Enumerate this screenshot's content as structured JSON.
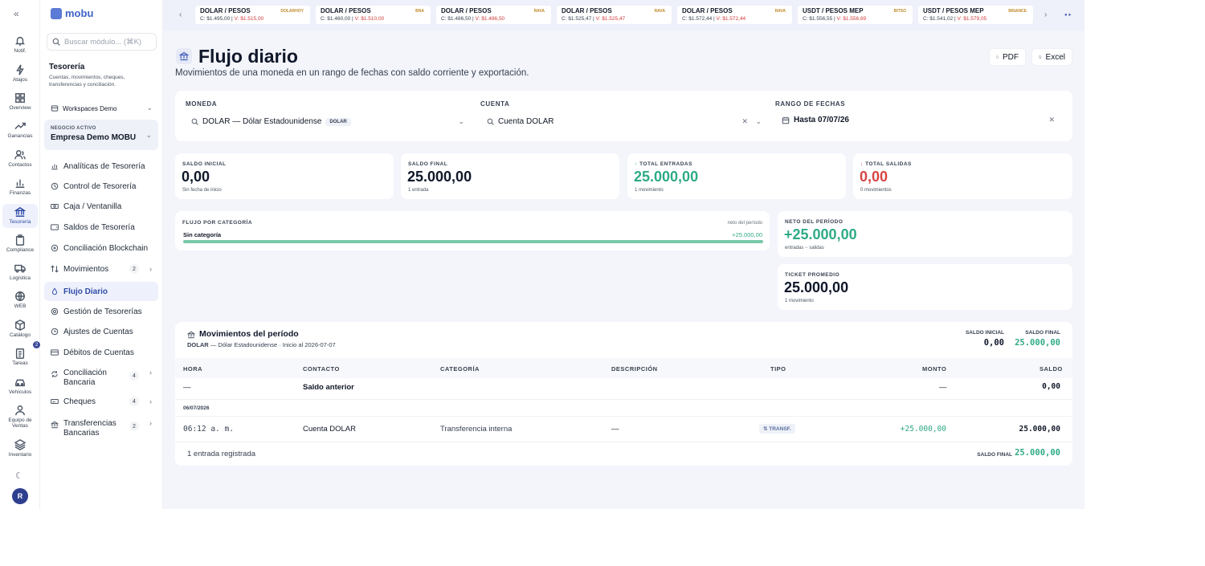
{
  "rail": {
    "items": [
      {
        "label": "Notif.",
        "icon": "bell-icon"
      },
      {
        "label": "Atajos",
        "icon": "bolt-icon"
      },
      {
        "label": "Overview",
        "icon": "grid-icon"
      },
      {
        "label": "Ganancias",
        "icon": "trend-icon"
      },
      {
        "label": "Contactos",
        "icon": "users-icon"
      },
      {
        "label": "Finanzas",
        "icon": "bar-chart-icon"
      },
      {
        "label": "Tesorería",
        "icon": "bank-icon"
      },
      {
        "label": "Compliance",
        "icon": "clipboard-icon"
      },
      {
        "label": "Logística",
        "icon": "box-icon"
      },
      {
        "label": "WEB",
        "icon": "globe-icon"
      },
      {
        "label": "Catálogo",
        "icon": "cube-icon"
      },
      {
        "label": "Tareas",
        "icon": "checklist-icon"
      },
      {
        "label": "Vehículos",
        "icon": "car-icon"
      },
      {
        "label": "Equipo de Ventas",
        "icon": "team-icon"
      },
      {
        "label": "Inventario",
        "icon": "layers-icon"
      }
    ],
    "tasks_badge": "2",
    "avatar": "R"
  },
  "sidebar": {
    "brand": "mobu",
    "search_placeholder": "Buscar módulo... (⌘K)",
    "section_title": "Tesorería",
    "section_sub": "Cuentas, movimientos, cheques, transferencias y conciliación.",
    "workspace": "Workspaces Demo",
    "business_label": "NEGOCIO ACTIVO",
    "business_name": "Empresa Demo MOBU",
    "nav": [
      {
        "label": "Analíticas de Tesorería"
      },
      {
        "label": "Control de Tesorería"
      },
      {
        "label": "Caja / Ventanilla"
      },
      {
        "label": "Saldos de Tesorería"
      },
      {
        "label": "Conciliación Blockchain"
      },
      {
        "label": "Movimientos",
        "count": "2"
      },
      {
        "label": "Flujo Diario"
      },
      {
        "label": "Gestión de Tesorerías"
      },
      {
        "label": "Ajustes de Cuentas"
      },
      {
        "label": "Débitos de Cuentas"
      },
      {
        "label": "Conciliación Bancaria",
        "count": "4"
      },
      {
        "label": "Cheques",
        "count": "4"
      },
      {
        "label": "Transferencias Bancarias",
        "count": "2"
      }
    ]
  },
  "ticker": [
    {
      "pair": "DOLAR / PESOS",
      "src": "DOLARHOY",
      "c": "C: $1.495,00",
      "v": "V: $1.515,00"
    },
    {
      "pair": "DOLAR / PESOS",
      "src": "BNA",
      "c": "C: $1.460,00",
      "v": "V: $1.510,00"
    },
    {
      "pair": "DOLAR / PESOS",
      "src": "RAVA",
      "c": "C: $1.486,50",
      "v": "V: $1.486,50"
    },
    {
      "pair": "DOLAR / PESOS",
      "src": "RAVA",
      "c": "C: $1.525,47",
      "v": "V: $1.525,47"
    },
    {
      "pair": "DOLAR / PESOS",
      "src": "RAVA",
      "c": "C: $1.572,44",
      "v": "V: $1.572,44"
    },
    {
      "pair": "USDT / PESOS MEP",
      "src": "BITSO",
      "c": "C: $1.556,55",
      "v": "V: $1.556,69"
    },
    {
      "pair": "USDT / PESOS MEP",
      "src": "BINANCE",
      "c": "C: $1.541,02",
      "v": "V: $1.579,05"
    }
  ],
  "page": {
    "title": "Flujo diario",
    "subtitle": "Movimientos de una moneda en un rango de fechas con saldo corriente y exportación.",
    "pdf": "PDF",
    "excel": "Excel"
  },
  "filters": {
    "currency_label": "MONEDA",
    "currency_value": "DOLAR — Dólar Estadounidense",
    "currency_chip": "DOLAR",
    "account_label": "CUENTA",
    "account_value": "Cuenta DOLAR",
    "range_label": "RANGO DE FECHAS",
    "range_value": "Hasta 07/07/26"
  },
  "kpis": [
    {
      "label": "SALDO INICIAL",
      "value": "0,00",
      "sub": "Sin fecha de inicio",
      "color": "#0f172a"
    },
    {
      "label": "SALDO FINAL",
      "value": "25.000,00",
      "sub": "1 entrada",
      "color": "#0f172a"
    },
    {
      "label": "TOTAL ENTRADAS",
      "value": "25.000,00",
      "sub": "1 movimiento",
      "color": "#2faa86"
    },
    {
      "label": "TOTAL SALIDAS",
      "value": "0,00",
      "sub": "0 movimientos",
      "color": "#d64545"
    }
  ],
  "category": {
    "title": "FLUJO POR CATEGORÍA",
    "right_hint": "neto del período",
    "row_label": "Sin categoría",
    "row_value": "+25.000,00",
    "fill_fraction": 1.0
  },
  "neto": {
    "label": "NETO DEL PERÍODO",
    "value": "+25.000,00",
    "sub": "entradas − salidas"
  },
  "ticket": {
    "label": "TICKET PROMEDIO",
    "value": "25.000,00",
    "sub": "1 movimiento"
  },
  "movs": {
    "title": "Movimientos del período",
    "sub_code": "DOLAR",
    "sub_rest": " — Dólar Estadounidense · Inicio al 2026-07-07",
    "saldo_inicial_label": "SALDO INICIAL",
    "saldo_inicial_value": "0,00",
    "saldo_final_label": "SALDO FINAL",
    "saldo_final_value": "25.000,00",
    "columns": [
      "HORA",
      "CONTACTO",
      "CATEGORÍA",
      "DESCRIPCIÓN",
      "TIPO",
      "MONTO",
      "SALDO"
    ],
    "prev_row": {
      "hora": "—",
      "contacto": "Saldo anterior",
      "monto": "—",
      "saldo": "0,00"
    },
    "date_group": "06/07/2026",
    "row": {
      "hora": "06:12 a. m.",
      "contacto": "Cuenta DOLAR",
      "categoria": "Transferencia interna",
      "descripcion": "—",
      "tipo": "TRANSF.",
      "monto": "+25.000,00",
      "saldo": "25.000,00"
    },
    "footer_left": "1 entrada registrada",
    "footer_label": "SALDO FINAL",
    "footer_value": "25.000,00"
  }
}
